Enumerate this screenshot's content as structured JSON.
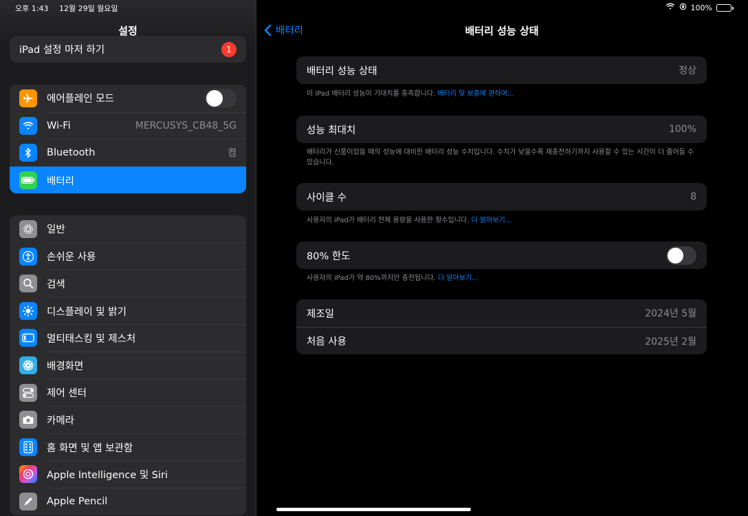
{
  "status": {
    "time": "오후 1:43",
    "date": "12월 29일 월요일",
    "battery_percent": "100%"
  },
  "sidebar": {
    "title": "설정",
    "setup": {
      "label": "iPad 설정 마저 하기",
      "badge": "1"
    },
    "group1": [
      {
        "label": "에어플레인 모드",
        "icon": "airplane-icon",
        "color": "#ff9500",
        "toggle": false
      },
      {
        "label": "Wi-Fi",
        "value": "MERCUSYS_CB48_5G",
        "icon": "wifi-icon",
        "color": "#0a84ff"
      },
      {
        "label": "Bluetooth",
        "value": "켬",
        "icon": "bluetooth-icon",
        "color": "#0a84ff"
      },
      {
        "label": "배터리",
        "icon": "battery-icon",
        "color": "#30d158",
        "selected": true
      }
    ],
    "group2": [
      {
        "label": "일반",
        "icon": "gear-icon",
        "color": "#8e8e93"
      },
      {
        "label": "손쉬운 사용",
        "icon": "accessibility-icon",
        "color": "#0a84ff"
      },
      {
        "label": "검색",
        "icon": "search-icon",
        "color": "#8e8e93"
      },
      {
        "label": "디스플레이 및 밝기",
        "icon": "brightness-icon",
        "color": "#0a84ff"
      },
      {
        "label": "멀티태스킹 및 제스처",
        "icon": "multitasking-icon",
        "color": "#0a84ff"
      },
      {
        "label": "배경화면",
        "icon": "wallpaper-icon",
        "color": "#32ade6"
      },
      {
        "label": "제어 센터",
        "icon": "control-center-icon",
        "color": "#8e8e93"
      },
      {
        "label": "카메라",
        "icon": "camera-icon",
        "color": "#8e8e93"
      },
      {
        "label": "홈 화면 및 앱 보관함",
        "icon": "home-screen-icon",
        "color": "#0a84ff"
      },
      {
        "label": "Apple Intelligence 및 Siri",
        "icon": "siri-icon",
        "color": "#bf5af2"
      },
      {
        "label": "Apple Pencil",
        "icon": "pencil-icon",
        "color": "#8e8e93"
      }
    ]
  },
  "main": {
    "back_label": "배터리",
    "title": "배터리 성능 상태",
    "health": {
      "label": "배터리 성능 상태",
      "value": "정상"
    },
    "health_note": "이 iPad 배터리 성능이 기대치를 충족합니다.",
    "health_link": "배터리 및 보증에 관하여...",
    "capacity": {
      "label": "성능 최대치",
      "value": "100%"
    },
    "capacity_note": "배터리가 신품이었을 때의 성능에 대비한 배터리 성능 수치입니다. 수치가 낮을수록 재충전하기까지 사용할 수 있는 시간이 더 줄어들 수 있습니다.",
    "cycles": {
      "label": "사이클 수",
      "value": "8"
    },
    "cycles_note": "사용자의 iPad가 배터리 전체 용량을 사용한 횟수입니다.",
    "cycles_link": "더 알아보기...",
    "limit": {
      "label": "80% 한도",
      "toggle": false
    },
    "limit_note": "사용자의 iPad가 약 80%까지만 충전됩니다.",
    "limit_link": "더 알아보기...",
    "manufactured": {
      "label": "제조일",
      "value": "2024년 5월"
    },
    "first_use": {
      "label": "처음 사용",
      "value": "2025년 2월"
    }
  }
}
